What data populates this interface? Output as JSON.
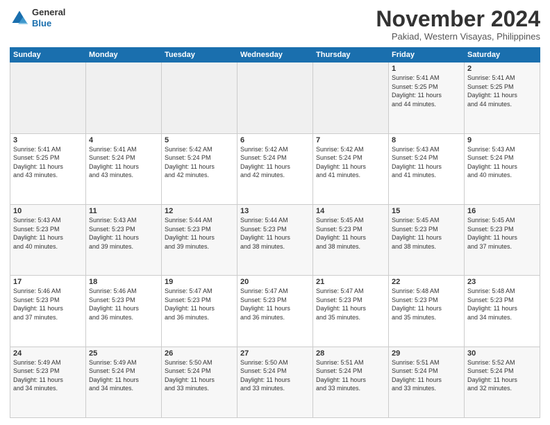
{
  "logo": {
    "general": "General",
    "blue": "Blue"
  },
  "header": {
    "month": "November 2024",
    "location": "Pakiad, Western Visayas, Philippines"
  },
  "days_of_week": [
    "Sunday",
    "Monday",
    "Tuesday",
    "Wednesday",
    "Thursday",
    "Friday",
    "Saturday"
  ],
  "weeks": [
    [
      {
        "day": "",
        "info": ""
      },
      {
        "day": "",
        "info": ""
      },
      {
        "day": "",
        "info": ""
      },
      {
        "day": "",
        "info": ""
      },
      {
        "day": "",
        "info": ""
      },
      {
        "day": "1",
        "info": "Sunrise: 5:41 AM\nSunset: 5:25 PM\nDaylight: 11 hours\nand 44 minutes."
      },
      {
        "day": "2",
        "info": "Sunrise: 5:41 AM\nSunset: 5:25 PM\nDaylight: 11 hours\nand 44 minutes."
      }
    ],
    [
      {
        "day": "3",
        "info": "Sunrise: 5:41 AM\nSunset: 5:25 PM\nDaylight: 11 hours\nand 43 minutes."
      },
      {
        "day": "4",
        "info": "Sunrise: 5:41 AM\nSunset: 5:24 PM\nDaylight: 11 hours\nand 43 minutes."
      },
      {
        "day": "5",
        "info": "Sunrise: 5:42 AM\nSunset: 5:24 PM\nDaylight: 11 hours\nand 42 minutes."
      },
      {
        "day": "6",
        "info": "Sunrise: 5:42 AM\nSunset: 5:24 PM\nDaylight: 11 hours\nand 42 minutes."
      },
      {
        "day": "7",
        "info": "Sunrise: 5:42 AM\nSunset: 5:24 PM\nDaylight: 11 hours\nand 41 minutes."
      },
      {
        "day": "8",
        "info": "Sunrise: 5:43 AM\nSunset: 5:24 PM\nDaylight: 11 hours\nand 41 minutes."
      },
      {
        "day": "9",
        "info": "Sunrise: 5:43 AM\nSunset: 5:24 PM\nDaylight: 11 hours\nand 40 minutes."
      }
    ],
    [
      {
        "day": "10",
        "info": "Sunrise: 5:43 AM\nSunset: 5:23 PM\nDaylight: 11 hours\nand 40 minutes."
      },
      {
        "day": "11",
        "info": "Sunrise: 5:43 AM\nSunset: 5:23 PM\nDaylight: 11 hours\nand 39 minutes."
      },
      {
        "day": "12",
        "info": "Sunrise: 5:44 AM\nSunset: 5:23 PM\nDaylight: 11 hours\nand 39 minutes."
      },
      {
        "day": "13",
        "info": "Sunrise: 5:44 AM\nSunset: 5:23 PM\nDaylight: 11 hours\nand 38 minutes."
      },
      {
        "day": "14",
        "info": "Sunrise: 5:45 AM\nSunset: 5:23 PM\nDaylight: 11 hours\nand 38 minutes."
      },
      {
        "day": "15",
        "info": "Sunrise: 5:45 AM\nSunset: 5:23 PM\nDaylight: 11 hours\nand 38 minutes."
      },
      {
        "day": "16",
        "info": "Sunrise: 5:45 AM\nSunset: 5:23 PM\nDaylight: 11 hours\nand 37 minutes."
      }
    ],
    [
      {
        "day": "17",
        "info": "Sunrise: 5:46 AM\nSunset: 5:23 PM\nDaylight: 11 hours\nand 37 minutes."
      },
      {
        "day": "18",
        "info": "Sunrise: 5:46 AM\nSunset: 5:23 PM\nDaylight: 11 hours\nand 36 minutes."
      },
      {
        "day": "19",
        "info": "Sunrise: 5:47 AM\nSunset: 5:23 PM\nDaylight: 11 hours\nand 36 minutes."
      },
      {
        "day": "20",
        "info": "Sunrise: 5:47 AM\nSunset: 5:23 PM\nDaylight: 11 hours\nand 36 minutes."
      },
      {
        "day": "21",
        "info": "Sunrise: 5:47 AM\nSunset: 5:23 PM\nDaylight: 11 hours\nand 35 minutes."
      },
      {
        "day": "22",
        "info": "Sunrise: 5:48 AM\nSunset: 5:23 PM\nDaylight: 11 hours\nand 35 minutes."
      },
      {
        "day": "23",
        "info": "Sunrise: 5:48 AM\nSunset: 5:23 PM\nDaylight: 11 hours\nand 34 minutes."
      }
    ],
    [
      {
        "day": "24",
        "info": "Sunrise: 5:49 AM\nSunset: 5:23 PM\nDaylight: 11 hours\nand 34 minutes."
      },
      {
        "day": "25",
        "info": "Sunrise: 5:49 AM\nSunset: 5:24 PM\nDaylight: 11 hours\nand 34 minutes."
      },
      {
        "day": "26",
        "info": "Sunrise: 5:50 AM\nSunset: 5:24 PM\nDaylight: 11 hours\nand 33 minutes."
      },
      {
        "day": "27",
        "info": "Sunrise: 5:50 AM\nSunset: 5:24 PM\nDaylight: 11 hours\nand 33 minutes."
      },
      {
        "day": "28",
        "info": "Sunrise: 5:51 AM\nSunset: 5:24 PM\nDaylight: 11 hours\nand 33 minutes."
      },
      {
        "day": "29",
        "info": "Sunrise: 5:51 AM\nSunset: 5:24 PM\nDaylight: 11 hours\nand 33 minutes."
      },
      {
        "day": "30",
        "info": "Sunrise: 5:52 AM\nSunset: 5:24 PM\nDaylight: 11 hours\nand 32 minutes."
      }
    ]
  ]
}
